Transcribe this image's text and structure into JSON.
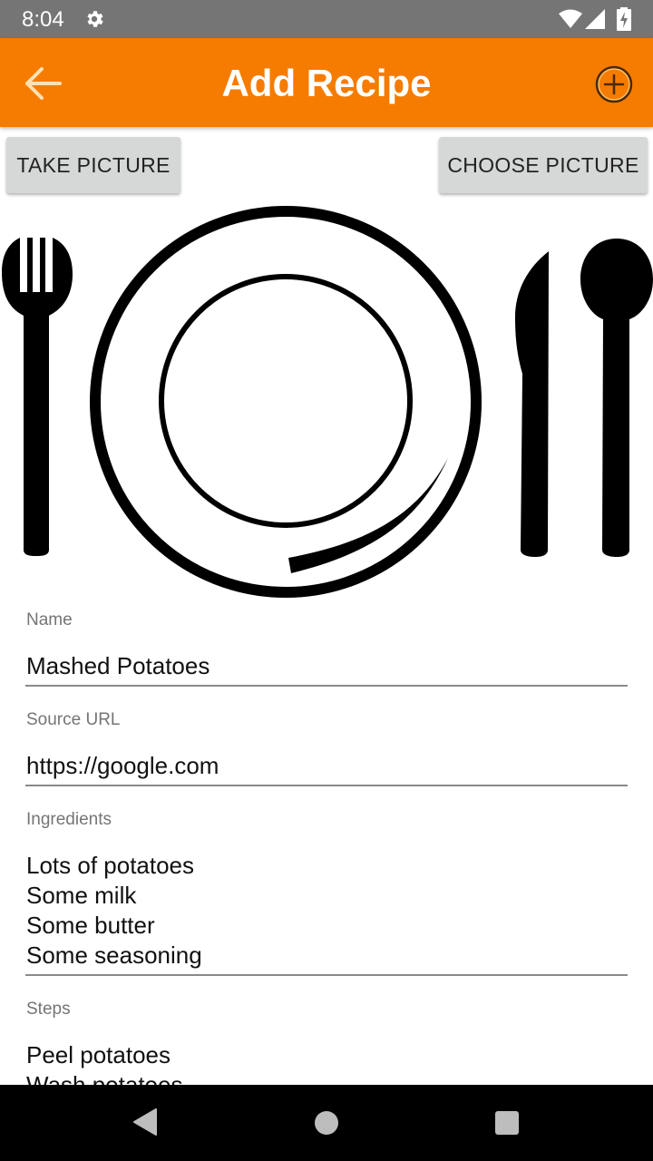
{
  "status_bar": {
    "time": "8:04",
    "icons": [
      "gear-icon",
      "wifi-icon",
      "signal-icon",
      "battery-charging-icon"
    ]
  },
  "app_bar": {
    "title": "Add Recipe",
    "back_icon": "arrow-left-icon",
    "add_icon": "plus-circle-icon",
    "color": "#f57c00"
  },
  "picture_buttons": {
    "take_label": "TAKE PICTURE",
    "choose_label": "CHOOSE PICTURE"
  },
  "illustration": {
    "icons": [
      "fork-icon",
      "plate-icon",
      "knife-icon",
      "spoon-icon"
    ]
  },
  "form": {
    "name": {
      "label": "Name",
      "value": "Mashed Potatoes"
    },
    "source_url": {
      "label": "Source URL",
      "value": "https://google.com"
    },
    "ingredients": {
      "label": "Ingredients",
      "value": "Lots of potatoes\nSome milk\nSome butter\nSome seasoning"
    },
    "steps": {
      "label": "Steps",
      "value": "Peel potatoes\nWash potatoes"
    }
  },
  "nav_bar": {
    "icons": [
      "back-triangle-icon",
      "home-circle-icon",
      "recents-square-icon"
    ]
  }
}
